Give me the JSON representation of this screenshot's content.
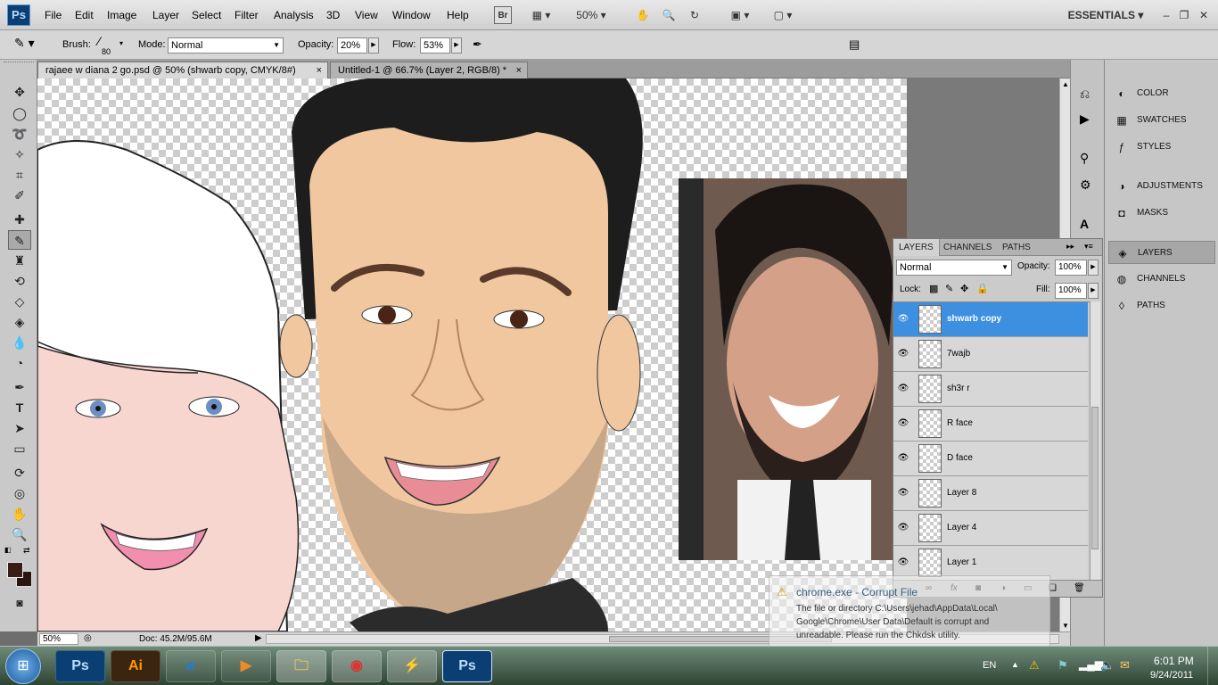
{
  "app": {
    "logo": "Ps",
    "workspace": "ESSENTIALS"
  },
  "menu": [
    "File",
    "Edit",
    "Image",
    "Layer",
    "Select",
    "Filter",
    "Analysis",
    "3D",
    "View",
    "Window",
    "Help"
  ],
  "menubar": {
    "bridge": "Br",
    "zoom": "50%"
  },
  "options": {
    "brush_label": "Brush:",
    "brush_size": "80",
    "mode_label": "Mode:",
    "mode_value": "Normal",
    "opacity_label": "Opacity:",
    "opacity_value": "20%",
    "flow_label": "Flow:",
    "flow_value": "53%"
  },
  "tabs": [
    {
      "label": "rajaee w diana 2 go.psd @ 50% (shwarb copy, CMYK/8#)",
      "close": "×"
    },
    {
      "label": "Untitled-1 @ 66.7% (Layer 2, RGB/8) *",
      "close": "×"
    }
  ],
  "status": {
    "zoom": "50%",
    "doc": "Doc: 45.2M/95.6M"
  },
  "panels": {
    "group1": [
      "COLOR",
      "SWATCHES",
      "STYLES"
    ],
    "group2": [
      "ADJUSTMENTS",
      "MASKS"
    ],
    "group3": [
      "LAYERS",
      "CHANNELS",
      "PATHS"
    ]
  },
  "layers": {
    "tabs": [
      "LAYERS",
      "CHANNELS",
      "PATHS"
    ],
    "blend_mode": "Normal",
    "opacity_label": "Opacity:",
    "opacity_value": "100%",
    "lock_label": "Lock:",
    "fill_label": "Fill:",
    "fill_value": "100%",
    "items": [
      {
        "name": "shwarb copy",
        "active": true
      },
      {
        "name": "7wajb"
      },
      {
        "name": "sh3r r"
      },
      {
        "name": "R face"
      },
      {
        "name": "D face"
      },
      {
        "name": "Layer 8"
      },
      {
        "name": "Layer 4"
      },
      {
        "name": "Layer 1"
      }
    ]
  },
  "notification": {
    "title": "chrome.exe - Corrupt File",
    "line1": "The file or directory C:\\Users\\jehad\\AppData\\Local\\",
    "line2": "Google\\Chrome\\User Data\\Default is corrupt and",
    "line3": "unreadable. Please run the Chkdsk utility."
  },
  "taskbar": {
    "apps": [
      "Ps",
      "Ai",
      "Ps"
    ],
    "lang": "EN",
    "time": "6:01 PM",
    "date": "9/24/2011"
  },
  "colors": {
    "active_layer": "#3d8fe0",
    "ps_blue": "#0b3f73",
    "ai_orange": "#ff9a00"
  }
}
